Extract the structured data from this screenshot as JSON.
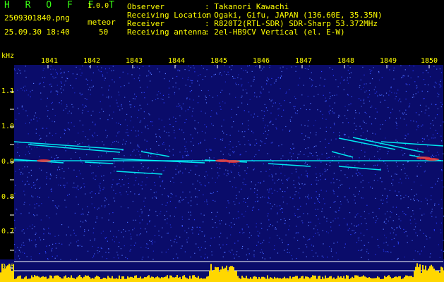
{
  "header": {
    "app_name": "H R O F F T",
    "app_version": "1.0.0",
    "file_name": "2509301840.png",
    "meteor_label": "meteor",
    "datetime": "25.09.30 18:40",
    "meteor_count": "50",
    "info": [
      {
        "key": "Observer",
        "value": ": Takanori Kawachi"
      },
      {
        "key": "Receiving Location",
        "value": ": Ogaki, Gifu, JAPAN (136.60E, 35.35N)"
      },
      {
        "key": "Receiver",
        "value": ": R820T2(RTL-SDR) SDR-Sharp 53.372MHz"
      },
      {
        "key": "Receiving antenna",
        "value": ": 2el-HB9CV Vertical (el. E-W)"
      }
    ]
  },
  "spectrogram": {
    "unit": "kHz",
    "time_ticks": [
      "1841",
      "1842",
      "1843",
      "1844",
      "1845",
      "1846",
      "1847",
      "1848",
      "1849",
      "1850"
    ],
    "freq_ticks": [
      "1.1",
      "1.0",
      "0.9",
      "0.8",
      "0.7",
      "0.6"
    ],
    "colors": {
      "background": "#0a0c6a",
      "text": "#ffff00",
      "title": "#39ff14",
      "carrier": "#00ffff",
      "hot": "#ff3030",
      "level": "#ffd700"
    }
  }
}
